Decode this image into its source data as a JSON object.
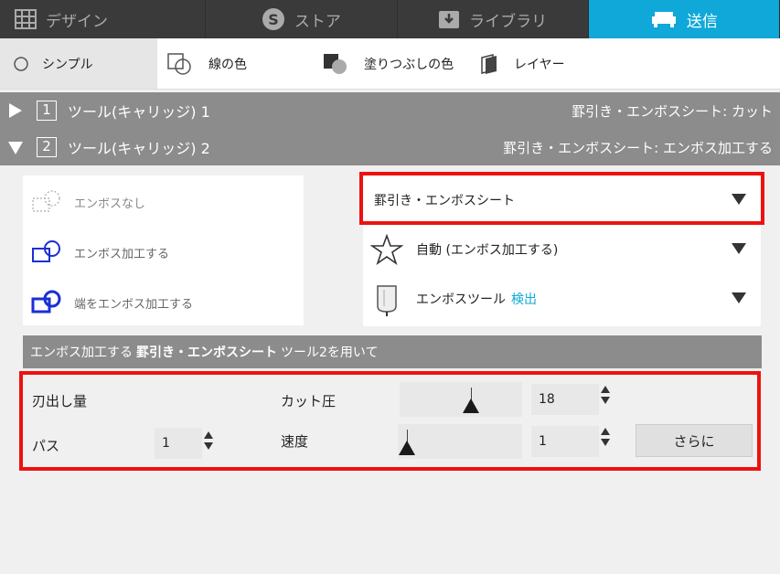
{
  "tabs": [
    {
      "label": "デザイン",
      "icon": "grid-icon"
    },
    {
      "label": "ストア",
      "icon": "store-s-icon"
    },
    {
      "label": "ライブラリ",
      "icon": "library-download-icon"
    },
    {
      "label": "送信",
      "icon": "cutter-machine-icon",
      "active": true
    }
  ],
  "stylebar": {
    "simple": "シンプル",
    "line_color": "線の色",
    "fill_color": "塗りつぶしの色",
    "layer": "レイヤー"
  },
  "tool1": {
    "num": "1",
    "label": "ツール(キャリッジ) 1",
    "material": "罫引き・エンボスシート: カット"
  },
  "tool2": {
    "num": "2",
    "label": "ツール(キャリッジ) 2",
    "material": "罫引き・エンボスシート: エンボス加工する"
  },
  "emboss_options": {
    "none": "エンボスなし",
    "emboss": "エンボス加工する",
    "edge": "端をエンボス加工する"
  },
  "dropdowns": {
    "material": "罫引き・エンボスシート",
    "action": "自動 (エンボス加工する)",
    "tool": "エンボスツール",
    "detect": "検出"
  },
  "info": {
    "prefix": "エンボス加工する",
    "material": "罫引き・エンボスシート",
    "suffix": "ツール2を用いて"
  },
  "settings": {
    "blade_label": "刃出し量",
    "passes_label": "パス",
    "passes_value": "1",
    "force_label": "カット圧",
    "force_value": "18",
    "force_fraction": 0.6,
    "speed_label": "速度",
    "speed_value": "1",
    "speed_fraction": 0.0,
    "more_label": "さらに"
  },
  "colors": {
    "accent": "#0fa8d8",
    "highlight": "#e11111",
    "header_gray": "#8c8c8c",
    "emboss_blue": "#1a2fd6"
  }
}
